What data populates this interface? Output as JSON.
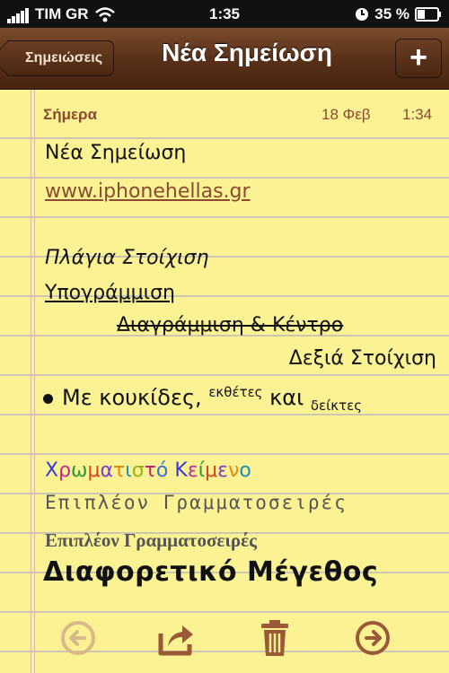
{
  "status": {
    "carrier": "TIM GR",
    "time": "1:35",
    "battery": "35 %"
  },
  "nav": {
    "back_label": "Σημειώσεις",
    "title": "Νέα Σημείωση",
    "add_label": "+"
  },
  "note": {
    "day": "Σήμερα",
    "date": "18 Φεβ",
    "time": "1:34",
    "line_title": "Νέα Σημείωση",
    "link": "www.iphonehellas.gr",
    "italic": "Πλάγια Στοίχιση",
    "underline": "Υπογράμμιση",
    "strike": "Διαγράμμιση & Κέντρο",
    "right_aligned": "Δεξιά Στοίχιση",
    "bullet_main": "Με κουκίδες,",
    "bullet_sup": "εκθέτες",
    "bullet_mid": "και",
    "bullet_sub": "δείκτες",
    "colored_text": "Χρωματιστό Κείμενο",
    "colored_palette": [
      "#3a3ad6",
      "#c02b8f",
      "#2f9a3a",
      "#d6451e",
      "#7c3fc4",
      "#e08a12",
      "#1e8fb8",
      "#9aaf1a",
      "#c81e6e",
      "#3d6fd8"
    ],
    "more_fonts_1": "Επιπλέον Γραμματοσειρές",
    "more_fonts_2": "Επιπλέον Γραμματοσειρές",
    "different_size": "Διαφορετικό Μέγεθος"
  },
  "toolbar": {
    "icons": [
      "previous-icon",
      "share-icon",
      "trash-icon",
      "next-icon"
    ]
  },
  "colors": {
    "nav_brown": "#5a3119",
    "paper": "#fbf294",
    "accent_brown": "#8b4a2f",
    "toolbar_icon": "#9a5a38"
  }
}
